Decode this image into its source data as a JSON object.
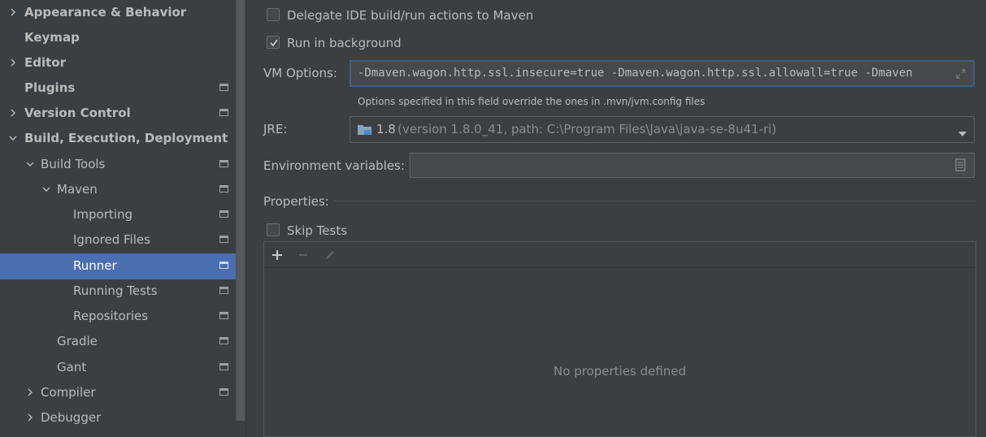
{
  "sidebar": {
    "items": [
      {
        "label": "Appearance & Behavior",
        "expander": "collapsed"
      },
      {
        "label": "Keymap",
        "expander": "none"
      },
      {
        "label": "Editor",
        "expander": "collapsed"
      },
      {
        "label": "Plugins",
        "expander": "none",
        "project_icon": true
      },
      {
        "label": "Version Control",
        "expander": "collapsed",
        "project_icon": true
      },
      {
        "label": "Build, Execution, Deployment",
        "expander": "expanded"
      },
      {
        "label": "Build Tools",
        "expander": "expanded",
        "project_icon": true
      },
      {
        "label": "Maven",
        "expander": "expanded",
        "project_icon": true
      },
      {
        "label": "Importing",
        "expander": "none",
        "project_icon": true
      },
      {
        "label": "Ignored Files",
        "expander": "none",
        "project_icon": true
      },
      {
        "label": "Runner",
        "expander": "none",
        "project_icon": true,
        "selected": true
      },
      {
        "label": "Running Tests",
        "expander": "none",
        "project_icon": true
      },
      {
        "label": "Repositories",
        "expander": "none",
        "project_icon": true
      },
      {
        "label": "Gradle",
        "expander": "none",
        "project_icon": true
      },
      {
        "label": "Gant",
        "expander": "none",
        "project_icon": true
      },
      {
        "label": "Compiler",
        "expander": "collapsed",
        "project_icon": true
      },
      {
        "label": "Debugger",
        "expander": "collapsed"
      }
    ]
  },
  "runner": {
    "delegate_label": "Delegate IDE build/run actions to Maven",
    "delegate_checked": false,
    "background_label": "Run in background",
    "background_checked": true,
    "vm_options_label": "VM Options:",
    "vm_options_value": "-Dmaven.wagon.http.ssl.insecure=true -Dmaven.wagon.http.ssl.allowall=true -Dmaven",
    "vm_options_hint": "Options specified in this field override the ones in .mvn/jvm.config files",
    "jre_label": "JRE:",
    "jre_version": "1.8",
    "jre_detail": "(version 1.8.0_41, path: C:\\Program Files\\Java\\java-se-8u41-ri)",
    "env_label": "Environment variables:",
    "env_value": "",
    "properties_label": "Properties:",
    "skip_tests_label": "Skip Tests",
    "skip_tests_checked": false,
    "empty_properties_text": "No properties defined"
  },
  "colors": {
    "background": "#3c3f41",
    "selection": "#4b6eaf",
    "focus_border": "#3d6185",
    "text": "#bbbbbb"
  }
}
